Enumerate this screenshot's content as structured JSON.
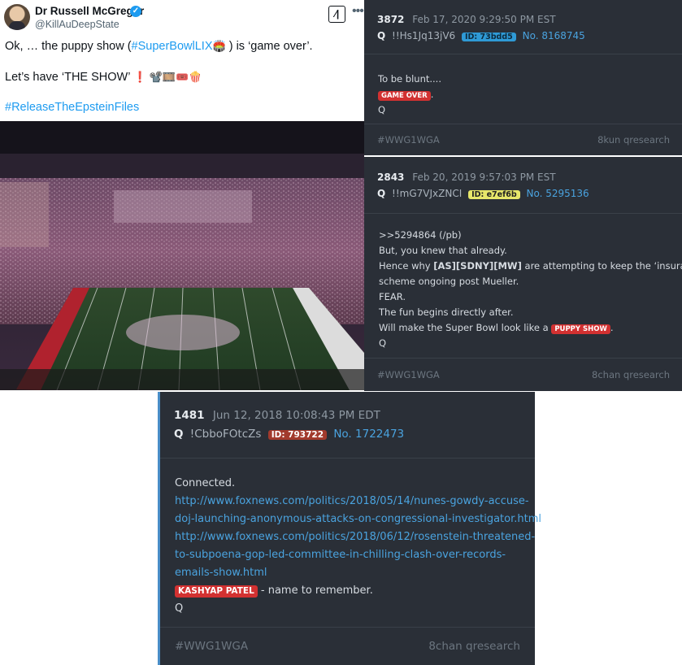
{
  "tweet": {
    "author_name": "Dr Russell McGregor",
    "author_handle": "@KillAuDeepState",
    "line1_pre": "Ok, … the puppy show (",
    "line1_link": "#SuperBowlLIX",
    "line1_emoji": "🏟️",
    "line1_post": " ) is ‘game over’.",
    "line2_text": "Let’s have ‘THE SHOW’ ",
    "line2_emojis": "❗ 📽️🎞️🎟️🍿",
    "hashtag": "#ReleaseTheEpsteinFiles",
    "photo_description_icon": "stadium-photo"
  },
  "posts": [
    {
      "number": "3872",
      "date": "Feb 17, 2020 9:29:50 PM EST",
      "name": "Q",
      "trip": "!!Hs1Jq13jV6",
      "id_label": "ID: 73bdd5",
      "id_color": "#2f9ad6",
      "id_text_color": "#0d2a3d",
      "post_no": "No. 8168745",
      "lines": [
        "To be blunt....",
        "GAME OVER",
        ".",
        "Q"
      ],
      "footer_left": "#WWG1WGA",
      "footer_right": "8kun qresearch"
    },
    {
      "number": "2843",
      "date": "Feb 20, 2019 9:57:03 PM EST",
      "name": "Q",
      "trip": "!!mG7VJxZNCI",
      "id_label": "ID: e7ef6b",
      "id_color": "#e6e66a",
      "id_text_color": "#222222",
      "post_no": "No. 5295136",
      "lines": [
        ">>5294864 (/pb)",
        "But, you knew that already.",
        "Hence why ",
        "[AS][SDNY][MW]",
        " are attempting to keep the ‘insurance’",
        "scheme ongoing post Mueller.",
        "FEAR.",
        "The fun begins directly after.",
        "Will make the Super Bowl look like a ",
        "PUPPY SHOW",
        ".",
        "Q"
      ],
      "footer_left": "#WWG1WGA",
      "footer_right": "8chan qresearch"
    },
    {
      "number": "1481",
      "date": "Jun 12, 2018 10:08:43 PM EDT",
      "name": "Q",
      "trip": "!CbboFOtcZs",
      "id_label": "ID: 793722",
      "id_color": "#a23a2c",
      "id_text_color": "#ffffff",
      "post_no": "No. 1722473",
      "lines": [
        "Connected.",
        "http://www.foxnews.com/politics/2018/05/14/nunes-gowdy-accuse-",
        "doj-launching-anonymous-attacks-on-congressional-investigator.html",
        "http://www.foxnews.com/politics/2018/06/12/rosenstein-threatened-",
        "to-subpoena-gop-led-committee-in-chilling-clash-over-records-",
        "emails-show.html",
        "KASHYAP PATEL",
        " - name to remember.",
        "Q"
      ],
      "footer_left": "#WWG1WGA",
      "footer_right": "8chan qresearch"
    }
  ]
}
